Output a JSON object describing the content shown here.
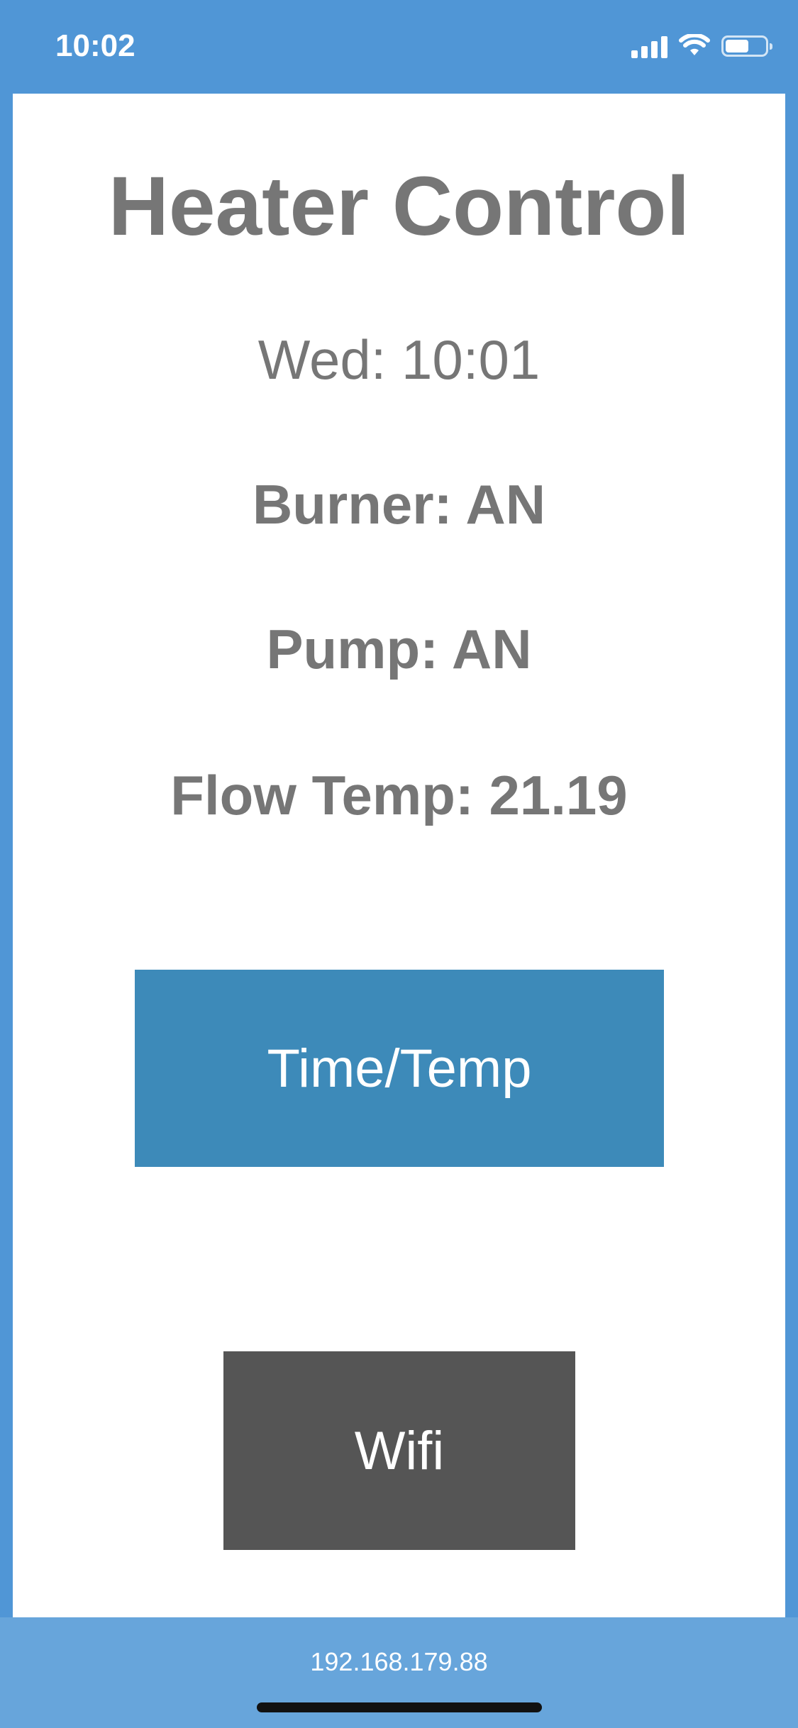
{
  "status_bar": {
    "time": "10:02",
    "icons": [
      "cellular-signal-icon",
      "wifi-icon",
      "battery-icon"
    ],
    "battery_level": 0.62
  },
  "main": {
    "title": "Heater Control",
    "day_time": "Wed: 10:01",
    "burner": "Burner: AN",
    "pump": "Pump: AN",
    "flow_temp": "Flow Temp: 21.19",
    "time_temp_button": "Time/Temp",
    "wifi_button": "Wifi"
  },
  "footer": {
    "ip_address": "192.168.179.88"
  },
  "colors": {
    "background": "#5096d6",
    "footer": "#67a5db",
    "text": "#767676",
    "time_temp_button": "#3d8ab9",
    "wifi_button": "#555555"
  }
}
